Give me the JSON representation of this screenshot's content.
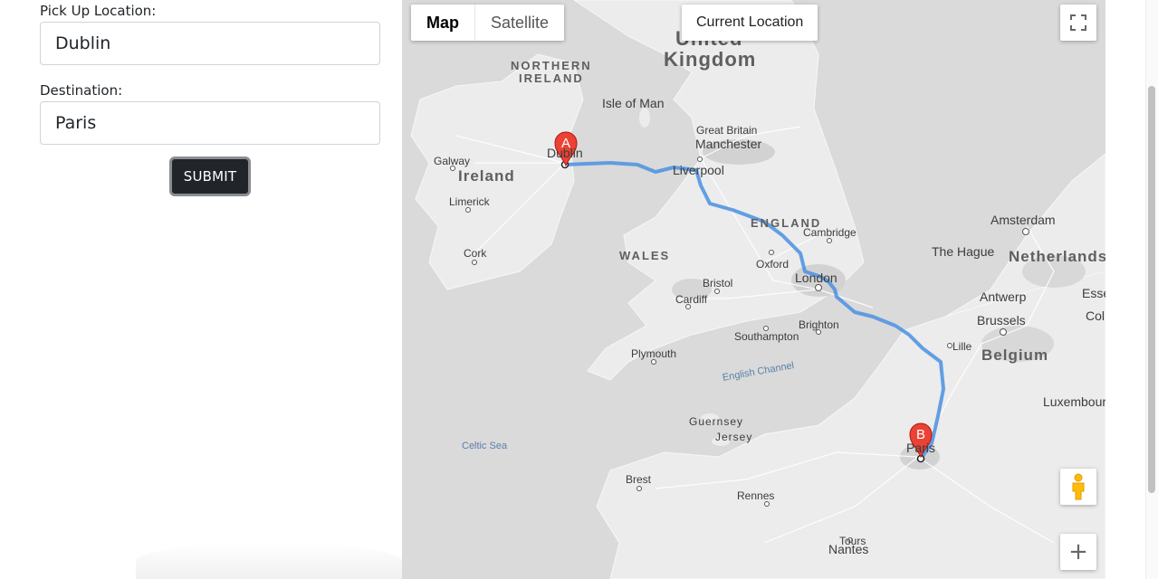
{
  "form": {
    "pickup_label": "Pick Up Location:",
    "pickup_value": "Dublin",
    "destination_label": "Destination:",
    "destination_value": "Paris",
    "submit_label": "SUBMIT"
  },
  "map": {
    "type_buttons": [
      "Map",
      "Satellite"
    ],
    "selected_type": "Map",
    "current_location_label": "Current Location",
    "zoom_in_symbol": "+",
    "markers": [
      "A",
      "B"
    ],
    "route_color": "#4a90e2",
    "marker_color": "#ea4335",
    "labels": {
      "uk1": "United",
      "uk2": "Kingdom",
      "ni1": "NORTHERN",
      "ni2": "IRELAND",
      "isle_of_man": "Isle of Man",
      "ireland": "Ireland",
      "galway": "Galway",
      "limerick": "Limerick",
      "cork": "Cork",
      "dublin": "Dublin",
      "great_britain": "Great Britain",
      "manchester": "Manchester",
      "liverpool": "Liverpool",
      "england": "ENGLAND",
      "wales": "WALES",
      "cambridge": "Cambridge",
      "oxford": "Oxford",
      "london": "London",
      "bristol": "Bristol",
      "cardiff": "Cardiff",
      "brighton": "Brighton",
      "southampton": "Southampton",
      "plymouth": "Plymouth",
      "english_channel": "English Channel",
      "guernsey": "Guernsey",
      "jersey": "Jersey",
      "celtic_sea": "Celtic Sea",
      "brest": "Brest",
      "rennes": "Rennes",
      "nantes": "Nantes",
      "tours": "Tours",
      "paris": "Paris",
      "amsterdam": "Amsterdam",
      "the_hague": "The Hague",
      "netherlands": "Netherlands",
      "antwerp": "Antwerp",
      "essen": "Essen",
      "brussels": "Brussels",
      "col": "Col",
      "lille": "Lille",
      "belgium": "Belgium",
      "luxembourg": "Luxembour"
    }
  },
  "icons": {
    "fullscreen": "fullscreen-icon",
    "pegman": "pegman-icon",
    "zoom_in": "zoom-in-icon"
  }
}
